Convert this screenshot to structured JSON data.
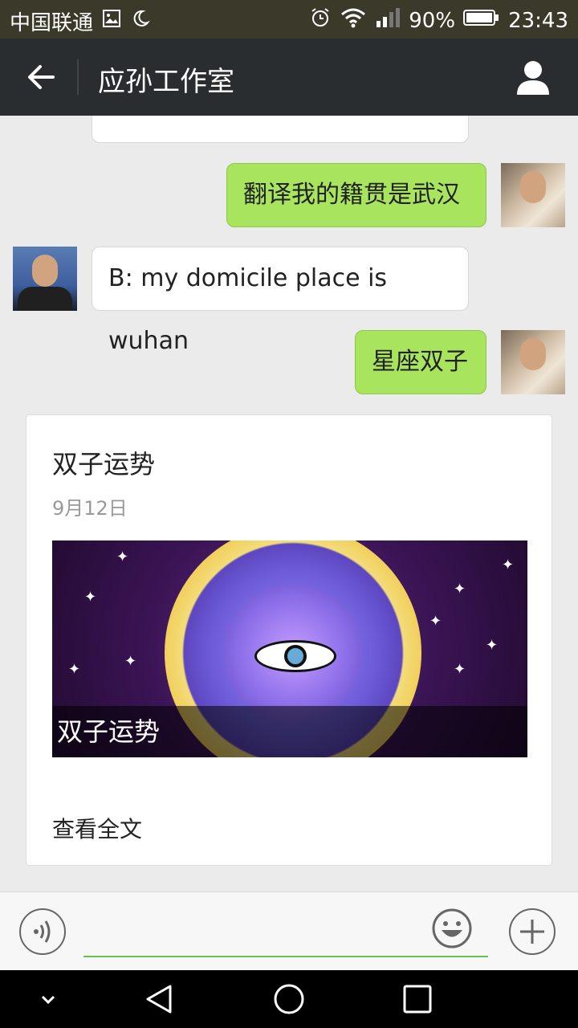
{
  "status_bar": {
    "carrier": "中国联通",
    "battery_percent": "90%",
    "time": "23:43"
  },
  "header": {
    "title": "应孙工作室"
  },
  "messages": [
    {
      "side": "right",
      "text": "翻译我的籍贯是武汉"
    },
    {
      "side": "left",
      "text": "B: my domicile place is wuhan"
    },
    {
      "side": "right",
      "text": "星座双子"
    }
  ],
  "article_card": {
    "title": "双子运势",
    "date": "9月12日",
    "image_caption": "双子运势",
    "read_more": "查看全文"
  },
  "colors": {
    "accent": "#69c14a",
    "bubble_green": "#a8e45e"
  }
}
